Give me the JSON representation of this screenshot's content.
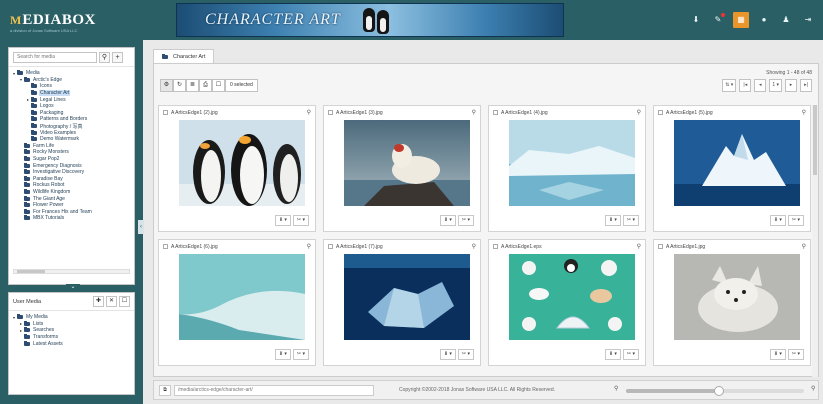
{
  "header": {
    "logo_mark": "M",
    "logo_text": "EDIABOX",
    "logo_sub": "a division of Jonas Software USA LLC",
    "banner_title": "CHARACTER ART",
    "icons": [
      "download-icon",
      "bell-icon",
      "grid-icon",
      "info-icon",
      "user-icon",
      "more-icon"
    ],
    "accent_color": "#e8952b",
    "bar_color": "#2a5f66"
  },
  "sidebar": {
    "search_placeholder": "Search for media",
    "tree": [
      {
        "label": "Media",
        "level": 0,
        "caret": "▾"
      },
      {
        "label": "Arctic's Edge",
        "level": 1,
        "caret": "▾"
      },
      {
        "label": "Icons",
        "level": 2,
        "caret": ""
      },
      {
        "label": "Character Art",
        "level": 2,
        "caret": "",
        "selected": true
      },
      {
        "label": "Legal Lines",
        "level": 2,
        "caret": "▸"
      },
      {
        "label": "Logos",
        "level": 2,
        "caret": ""
      },
      {
        "label": "Packaging",
        "level": 2,
        "caret": ""
      },
      {
        "label": "Patterns and Borders",
        "level": 2,
        "caret": ""
      },
      {
        "label": "Photography / 写真",
        "level": 2,
        "caret": ""
      },
      {
        "label": "Video Examples",
        "level": 2,
        "caret": ""
      },
      {
        "label": "Demo Watermark",
        "level": 2,
        "caret": ""
      },
      {
        "label": "Farm Life",
        "level": 1,
        "caret": ""
      },
      {
        "label": "Rocky Monsters",
        "level": 1,
        "caret": ""
      },
      {
        "label": "Sugar Pop2",
        "level": 1,
        "caret": ""
      },
      {
        "label": "Emergency Diagnosis",
        "level": 1,
        "caret": ""
      },
      {
        "label": "Investigative Discovery",
        "level": 1,
        "caret": ""
      },
      {
        "label": "Paradise Bay",
        "level": 1,
        "caret": ""
      },
      {
        "label": "Rockus Robot",
        "level": 1,
        "caret": ""
      },
      {
        "label": "Wildlife Kingdom",
        "level": 1,
        "caret": ""
      },
      {
        "label": "The Giant Age",
        "level": 1,
        "caret": ""
      },
      {
        "label": "Flower Power",
        "level": 1,
        "caret": ""
      },
      {
        "label": "For Frances Hix and Team",
        "level": 1,
        "caret": ""
      },
      {
        "label": "MBX Tutorials",
        "level": 1,
        "caret": ""
      }
    ],
    "user_media_title": "User Media",
    "user_tree": [
      {
        "label": "My Media",
        "level": 0,
        "caret": "▾"
      },
      {
        "label": "Lists",
        "level": 1,
        "caret": "▸"
      },
      {
        "label": "Searches",
        "level": 1,
        "caret": "▸"
      },
      {
        "label": "Transforms",
        "level": 1,
        "caret": ""
      },
      {
        "label": "Latest Assets",
        "level": 1,
        "caret": ""
      }
    ]
  },
  "main": {
    "tab_label": "Character Art",
    "showing": "Showing 1 - 48 of 48",
    "selected_label": "0 selected",
    "pager": [
      "⇅ ▾",
      "|◂",
      "◂",
      "1 ▾",
      "▸",
      "▸|"
    ],
    "cards": [
      {
        "name": "A ArticsEdge1 (2).jpg",
        "art": "penguins"
      },
      {
        "name": "A ArticsEdge1 (3).jpg",
        "art": "bear"
      },
      {
        "name": "A ArticsEdge1 (4).jpg",
        "art": "icewater"
      },
      {
        "name": "A ArticsEdge1 (5).jpg",
        "art": "iceberg"
      },
      {
        "name": "A ArticsEdge1 (6).jpg",
        "art": "glacier"
      },
      {
        "name": "A ArticsEdge1 (7).jpg",
        "art": "ice-dark"
      },
      {
        "name": "A ArticsEdge1.eps",
        "art": "cartoon"
      },
      {
        "name": "A ArticsEdge1.jpg",
        "art": "fox"
      }
    ],
    "card_download_label": "⬇ ▾",
    "card_share_label": "✂ ▾"
  },
  "footer": {
    "path": "/media/arctics-edge/character-art/",
    "copyright": "Copyright ©2002-2018 Jonas Software USA LLC. All Rights Reserved.",
    "zoom_level": 0.52
  }
}
